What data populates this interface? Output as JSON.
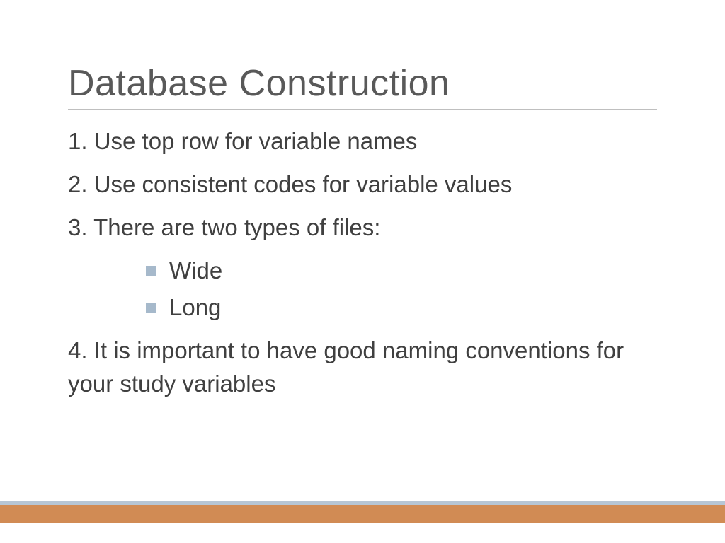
{
  "title": "Database Construction",
  "items": [
    "1. Use top row for variable names",
    "2. Use consistent codes for variable values",
    "3. There are two types of files:",
    "4. It is important to have good naming conventions for your study variables"
  ],
  "subitems": [
    "Wide",
    "Long"
  ]
}
